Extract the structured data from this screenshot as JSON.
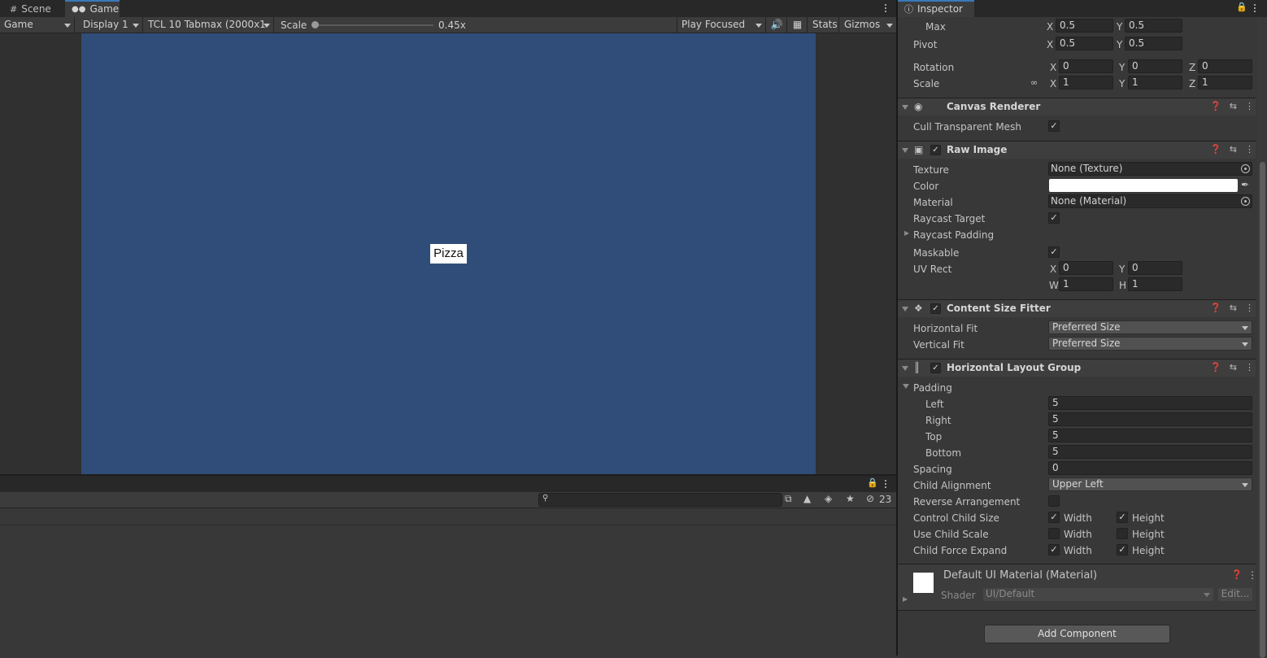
{
  "tabs": {
    "scene": "Scene",
    "game": "Game"
  },
  "game_toolbar": {
    "mode": "Game",
    "display": "Display 1",
    "resolution": "TCL 10 Tabmax (2000x1",
    "scale_label": "Scale",
    "scale_value": "0.45x",
    "scale_level": 0.0,
    "play_mode": "Play Focused",
    "stats": "Stats",
    "gizmos": "Gizmos"
  },
  "game_view": {
    "canvas_color": "#2f4d78",
    "pizza_label": "Pizza"
  },
  "console": {
    "search_placeholder": "",
    "hidden_count": "23"
  },
  "inspector": {
    "tab": "Inspector",
    "max": {
      "label": "Max",
      "x": "0.5",
      "y": "0.5"
    },
    "pivot": {
      "label": "Pivot",
      "x": "0.5",
      "y": "0.5"
    },
    "rotation": {
      "label": "Rotation",
      "x": "0",
      "y": "0",
      "z": "0"
    },
    "scale": {
      "label": "Scale",
      "x": "1",
      "y": "1",
      "z": "1"
    },
    "canvas_renderer": {
      "title": "Canvas Renderer",
      "cull_label": "Cull Transparent Mesh"
    },
    "raw_image": {
      "title": "Raw Image",
      "texture_label": "Texture",
      "texture_value": "None (Texture)",
      "color_label": "Color",
      "color_value": "#ffffff",
      "material_label": "Material",
      "material_value": "None (Material)",
      "raycast_target": "Raycast Target",
      "raycast_padding": "Raycast Padding",
      "maskable": "Maskable",
      "uv_rect": "UV Rect",
      "uv_x": "0",
      "uv_y": "0",
      "uv_w": "1",
      "uv_h": "1"
    },
    "content_size_fitter": {
      "title": "Content Size Fitter",
      "hfit_label": "Horizontal Fit",
      "hfit_value": "Preferred Size",
      "vfit_label": "Vertical Fit",
      "vfit_value": "Preferred Size"
    },
    "horizontal_layout_group": {
      "title": "Horizontal Layout Group",
      "padding": "Padding",
      "left_label": "Left",
      "left": "5",
      "right_label": "Right",
      "right": "5",
      "top_label": "Top",
      "top": "5",
      "bottom_label": "Bottom",
      "bottom": "5",
      "spacing_label": "Spacing",
      "spacing": "0",
      "child_alignment_label": "Child Alignment",
      "child_alignment": "Upper Left",
      "reverse_label": "Reverse Arrangement",
      "control_child_size": "Control Child Size",
      "use_child_scale": "Use Child Scale",
      "child_force_expand": "Child Force Expand",
      "width": "Width",
      "height": "Height"
    },
    "material": {
      "title": "Default UI Material (Material)",
      "shader_label": "Shader",
      "shader_value": "UI/Default",
      "edit": "Edit..."
    },
    "add_component": "Add Component"
  }
}
